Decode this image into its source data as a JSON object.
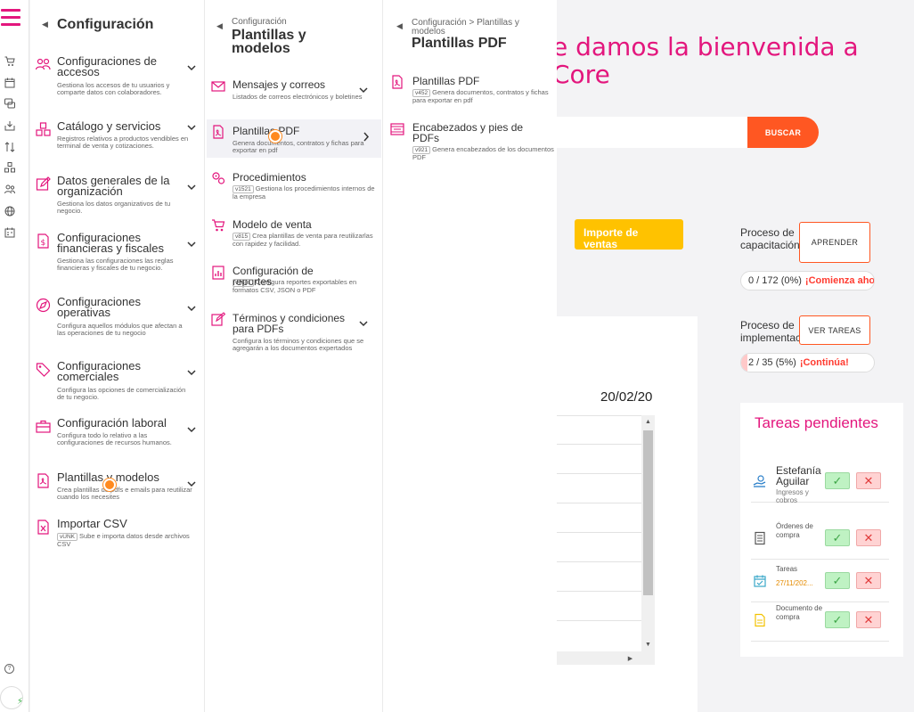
{
  "colors": {
    "brand": "#e3167d",
    "accent": "#ff5722",
    "sales": "#ffc200"
  },
  "dashboard": {
    "welcome_line1": "e damos la bienvenida a",
    "welcome_line2": "Core",
    "search_button": "BUSCAR",
    "sales_card": "Importe de ventas",
    "date": "20/02/20",
    "training": {
      "label": "Proceso de capacitación:",
      "button": "APRENDER",
      "progress": "0 / 172 (0%)",
      "progress_pct": 0,
      "cta": "¡Comienza ahora!"
    },
    "implementation": {
      "label": "Proceso de implementación:",
      "button": "VER TAREAS",
      "progress": "2 / 35 (5%)",
      "progress_pct": 5,
      "cta": "¡Continúa!"
    },
    "tasks": {
      "title": "Tareas pendientes",
      "items": [
        {
          "name": "Estefanía Aguilar",
          "sub": "Ingresos y cobros",
          "icon": "hand-money-icon"
        },
        {
          "name": "Órdenes de compra",
          "sub": "",
          "icon": "document-icon"
        },
        {
          "name": "Tareas",
          "sub": "27/11/202...",
          "icon": "calendar-check-icon"
        },
        {
          "name": "Documento de compra",
          "sub": "",
          "icon": "file-yellow-icon"
        }
      ]
    }
  },
  "menu1": {
    "title": "Configuración",
    "items": [
      {
        "label": "Configuraciones de accesos",
        "desc": "Gestiona los accesos de tu usuarios y comparte datos con colaboradores.",
        "icon": "users-icon"
      },
      {
        "label": "Catálogo y servicios",
        "desc": "Registros relativos a productos vendibles en terminal de venta y cotizaciones.",
        "icon": "boxes-icon"
      },
      {
        "label": "Datos generales de la organización",
        "desc": "Gestiona los datos organizativos de tu negocio.",
        "icon": "edit-icon"
      },
      {
        "label": "Configuraciones financieras y fiscales",
        "desc": "Gestiona las configuraciones las reglas financieras y fiscales de tu negocio.",
        "icon": "dollar-file-icon"
      },
      {
        "label": "Configuraciones operativas",
        "desc": "Configura aquellos módulos que afectan a las operaciones de tu negocio",
        "icon": "compass-icon"
      },
      {
        "label": "Configuraciones comerciales",
        "desc": "Configura las opciones de comercialización de tu negocio.",
        "icon": "tag-icon"
      },
      {
        "label": "Configuración laboral",
        "desc": "Configura todo lo relativo a las configuraciones de recursos humanos.",
        "icon": "briefcase-icon"
      },
      {
        "label": "Plantillas y modelos",
        "desc": "Crea plantillas de pdfs e emails para reutilizar cuando los necesites",
        "icon": "pdf-file-icon"
      },
      {
        "label": "Importar CSV",
        "desc": "Sube e importa datos desde archivos CSV",
        "badge": "vUNK",
        "icon": "excel-file-icon"
      }
    ]
  },
  "menu2": {
    "crumb": "Configuración",
    "title": "Plantillas y modelos",
    "items": [
      {
        "label": "Mensajes y correos",
        "desc": "Listados de correos electrónicos y boletines",
        "icon": "mail-icon"
      },
      {
        "label": "Plantillas PDF",
        "desc": "Genera documentos, contratos y fichas para exportar en pdf",
        "icon": "pdf-file-icon"
      },
      {
        "label": "Procedimientos",
        "badge": "v1521",
        "desc": "Gestiona los procedimientos internos de la empresa",
        "icon": "gears-icon"
      },
      {
        "label": "Modelo de venta",
        "badge": "v815",
        "desc": "Crea plantillas de venta para reutilizarlas con rapidez y facilidad.",
        "icon": "cart-icon"
      },
      {
        "label": "Configuración de reportes",
        "badge": "v1681",
        "desc": "Configura reportes exportables en formatos CSV, JSON o PDF",
        "icon": "report-icon"
      },
      {
        "label": "Términos y condiciones para PDFs",
        "desc": "Configura los términos y condiciones que se agregarán a los documentos expertados",
        "icon": "signature-icon"
      }
    ]
  },
  "menu3": {
    "crumb": "Configuración > Plantillas y modelos",
    "title": "Plantillas PDF",
    "items": [
      {
        "label": "Plantillas PDF",
        "badge": "v452",
        "desc": "Genera documentos, contratos y fichas para exportar en pdf",
        "icon": "pdf-file-icon"
      },
      {
        "label": "Encabezados y pies de PDFs",
        "badge": "v921",
        "desc": "Genera encabezados de los documentos PDF",
        "icon": "header-footer-icon"
      }
    ]
  }
}
